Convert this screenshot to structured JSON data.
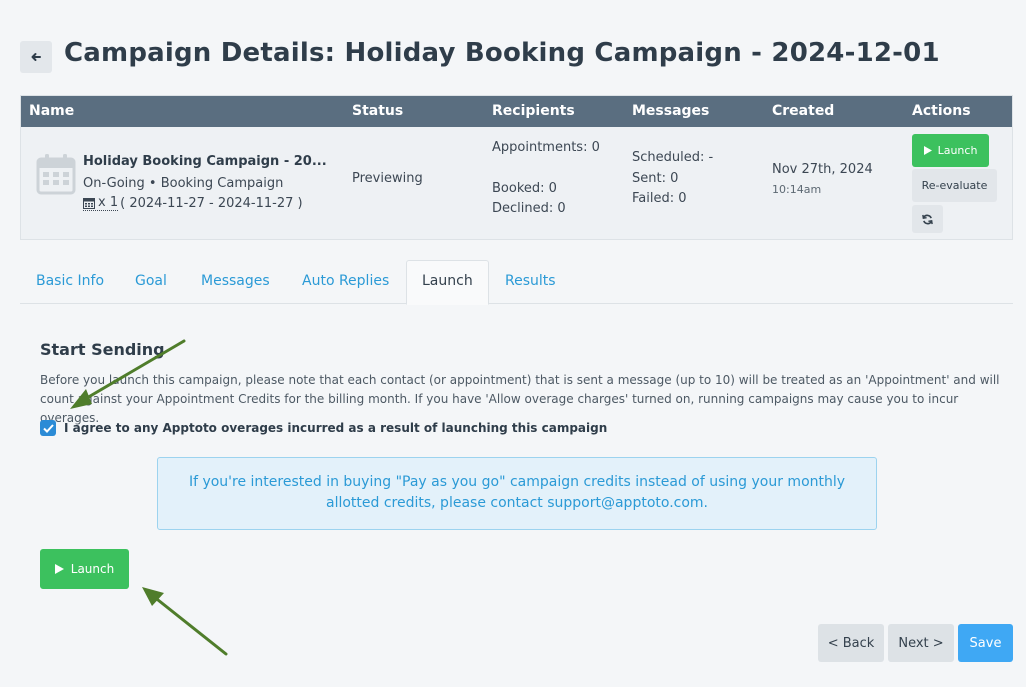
{
  "header": {
    "title": "Campaign Details: Holiday Booking Campaign - 2024-12-01"
  },
  "table": {
    "columns": [
      "Name",
      "Status",
      "Recipients",
      "Messages",
      "Created",
      "Actions"
    ],
    "row": {
      "name": "Holiday Booking Campaign - 20...",
      "type": "On-Going • Booking Campaign",
      "range_prefix": "x 1",
      "range": "( 2024-11-27 - 2024-11-27 )",
      "status": "Previewing",
      "recipients": {
        "appointments": "Appointments: 0",
        "booked": "Booked: 0",
        "declined": "Declined: 0"
      },
      "messages": {
        "scheduled": "Scheduled: -",
        "sent": "Sent: 0",
        "failed": "Failed: 0"
      },
      "created_date": "Nov 27th, 2024",
      "created_time": "10:14am",
      "actions": {
        "launch": "Launch",
        "reevaluate": "Re-evaluate"
      }
    }
  },
  "tabs": [
    {
      "label": "Basic Info"
    },
    {
      "label": "Goal"
    },
    {
      "label": "Messages"
    },
    {
      "label": "Auto Replies"
    },
    {
      "label": "Launch"
    },
    {
      "label": "Results"
    }
  ],
  "launch_section": {
    "title": "Start Sending",
    "notice": "Before you launch this campaign, please note that each contact (or appointment) that is sent a message (up to 10) will be treated as an 'Appointment' and will count against your Appointment Credits for the billing month. If you have 'Allow overage charges' turned on, running campaigns may cause you to incur overages.",
    "agree_label": "I agree to any Apptoto overages incurred as a result of launching this campaign",
    "agree_checked": true,
    "info": "If you're interested in buying \"Pay as you go\" campaign credits instead of using your monthly allotted credits, please contact support@apptoto.com.",
    "launch_label": "Launch"
  },
  "footer": {
    "back_label": "< Back",
    "next_label": "Next >",
    "save_label": "Save"
  },
  "colors": {
    "header_bg": "#5a6e80",
    "launch_green": "#3cc15e",
    "link_blue": "#2b9ad6",
    "save_blue": "#3fa8f4",
    "annotation_arrow": "#4f7d2b"
  },
  "icons": [
    "back-arrow-icon",
    "calendar-icon",
    "play-icon",
    "refresh-icon",
    "checkmark-icon"
  ]
}
